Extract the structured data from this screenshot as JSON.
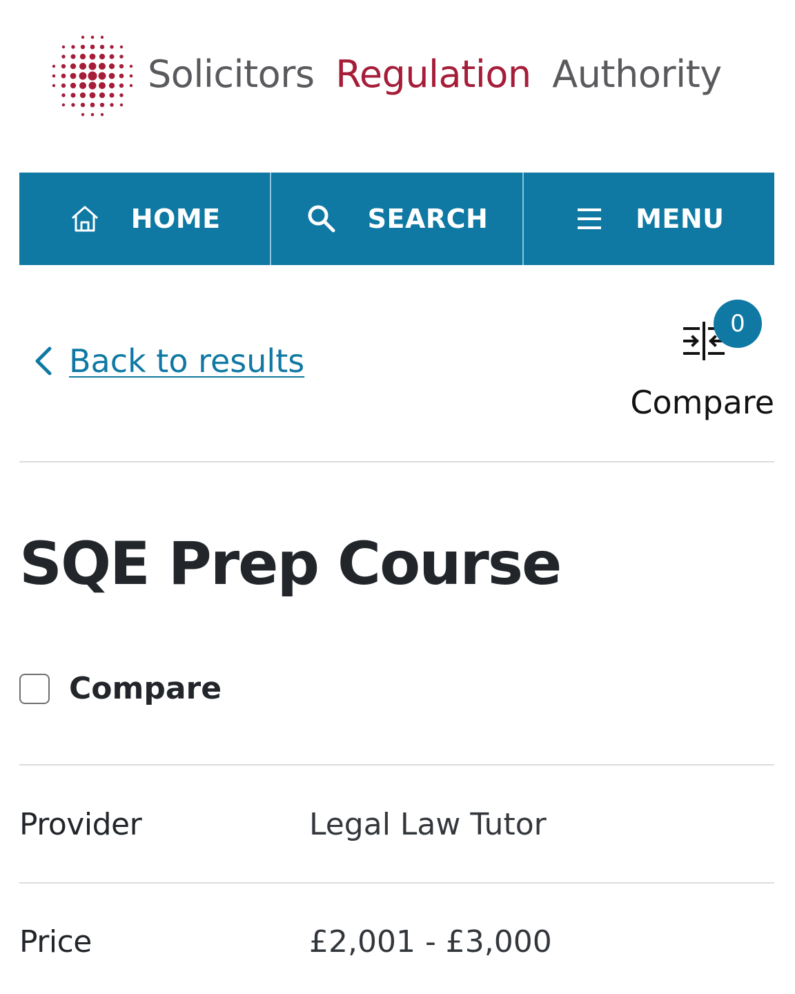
{
  "header": {
    "logo_word1": "Solicitors",
    "logo_word2": "Regulation",
    "logo_word3": "Authority",
    "logo_icon": "dot-grid-logo-icon",
    "brand_red": "#a51d38",
    "brand_grey": "#5a5a5e"
  },
  "nav": {
    "color": "#0f79a3",
    "items": [
      {
        "label": "HOME",
        "icon": "home-icon"
      },
      {
        "label": "SEARCH",
        "icon": "search-icon"
      },
      {
        "label": "MENU",
        "icon": "hamburger-menu-icon"
      }
    ]
  },
  "back": {
    "label": "Back to results",
    "icon": "chevron-left-icon"
  },
  "compare_widget": {
    "count": "0",
    "label": "Compare",
    "icon": "compare-icon"
  },
  "course": {
    "title": "SQE Prep Course",
    "compare_checkbox_label": "Compare",
    "compare_checked": false
  },
  "details": [
    {
      "label": "Provider",
      "value": "Legal Law Tutor"
    },
    {
      "label": "Price",
      "value": "£2,001 - £3,000"
    }
  ]
}
